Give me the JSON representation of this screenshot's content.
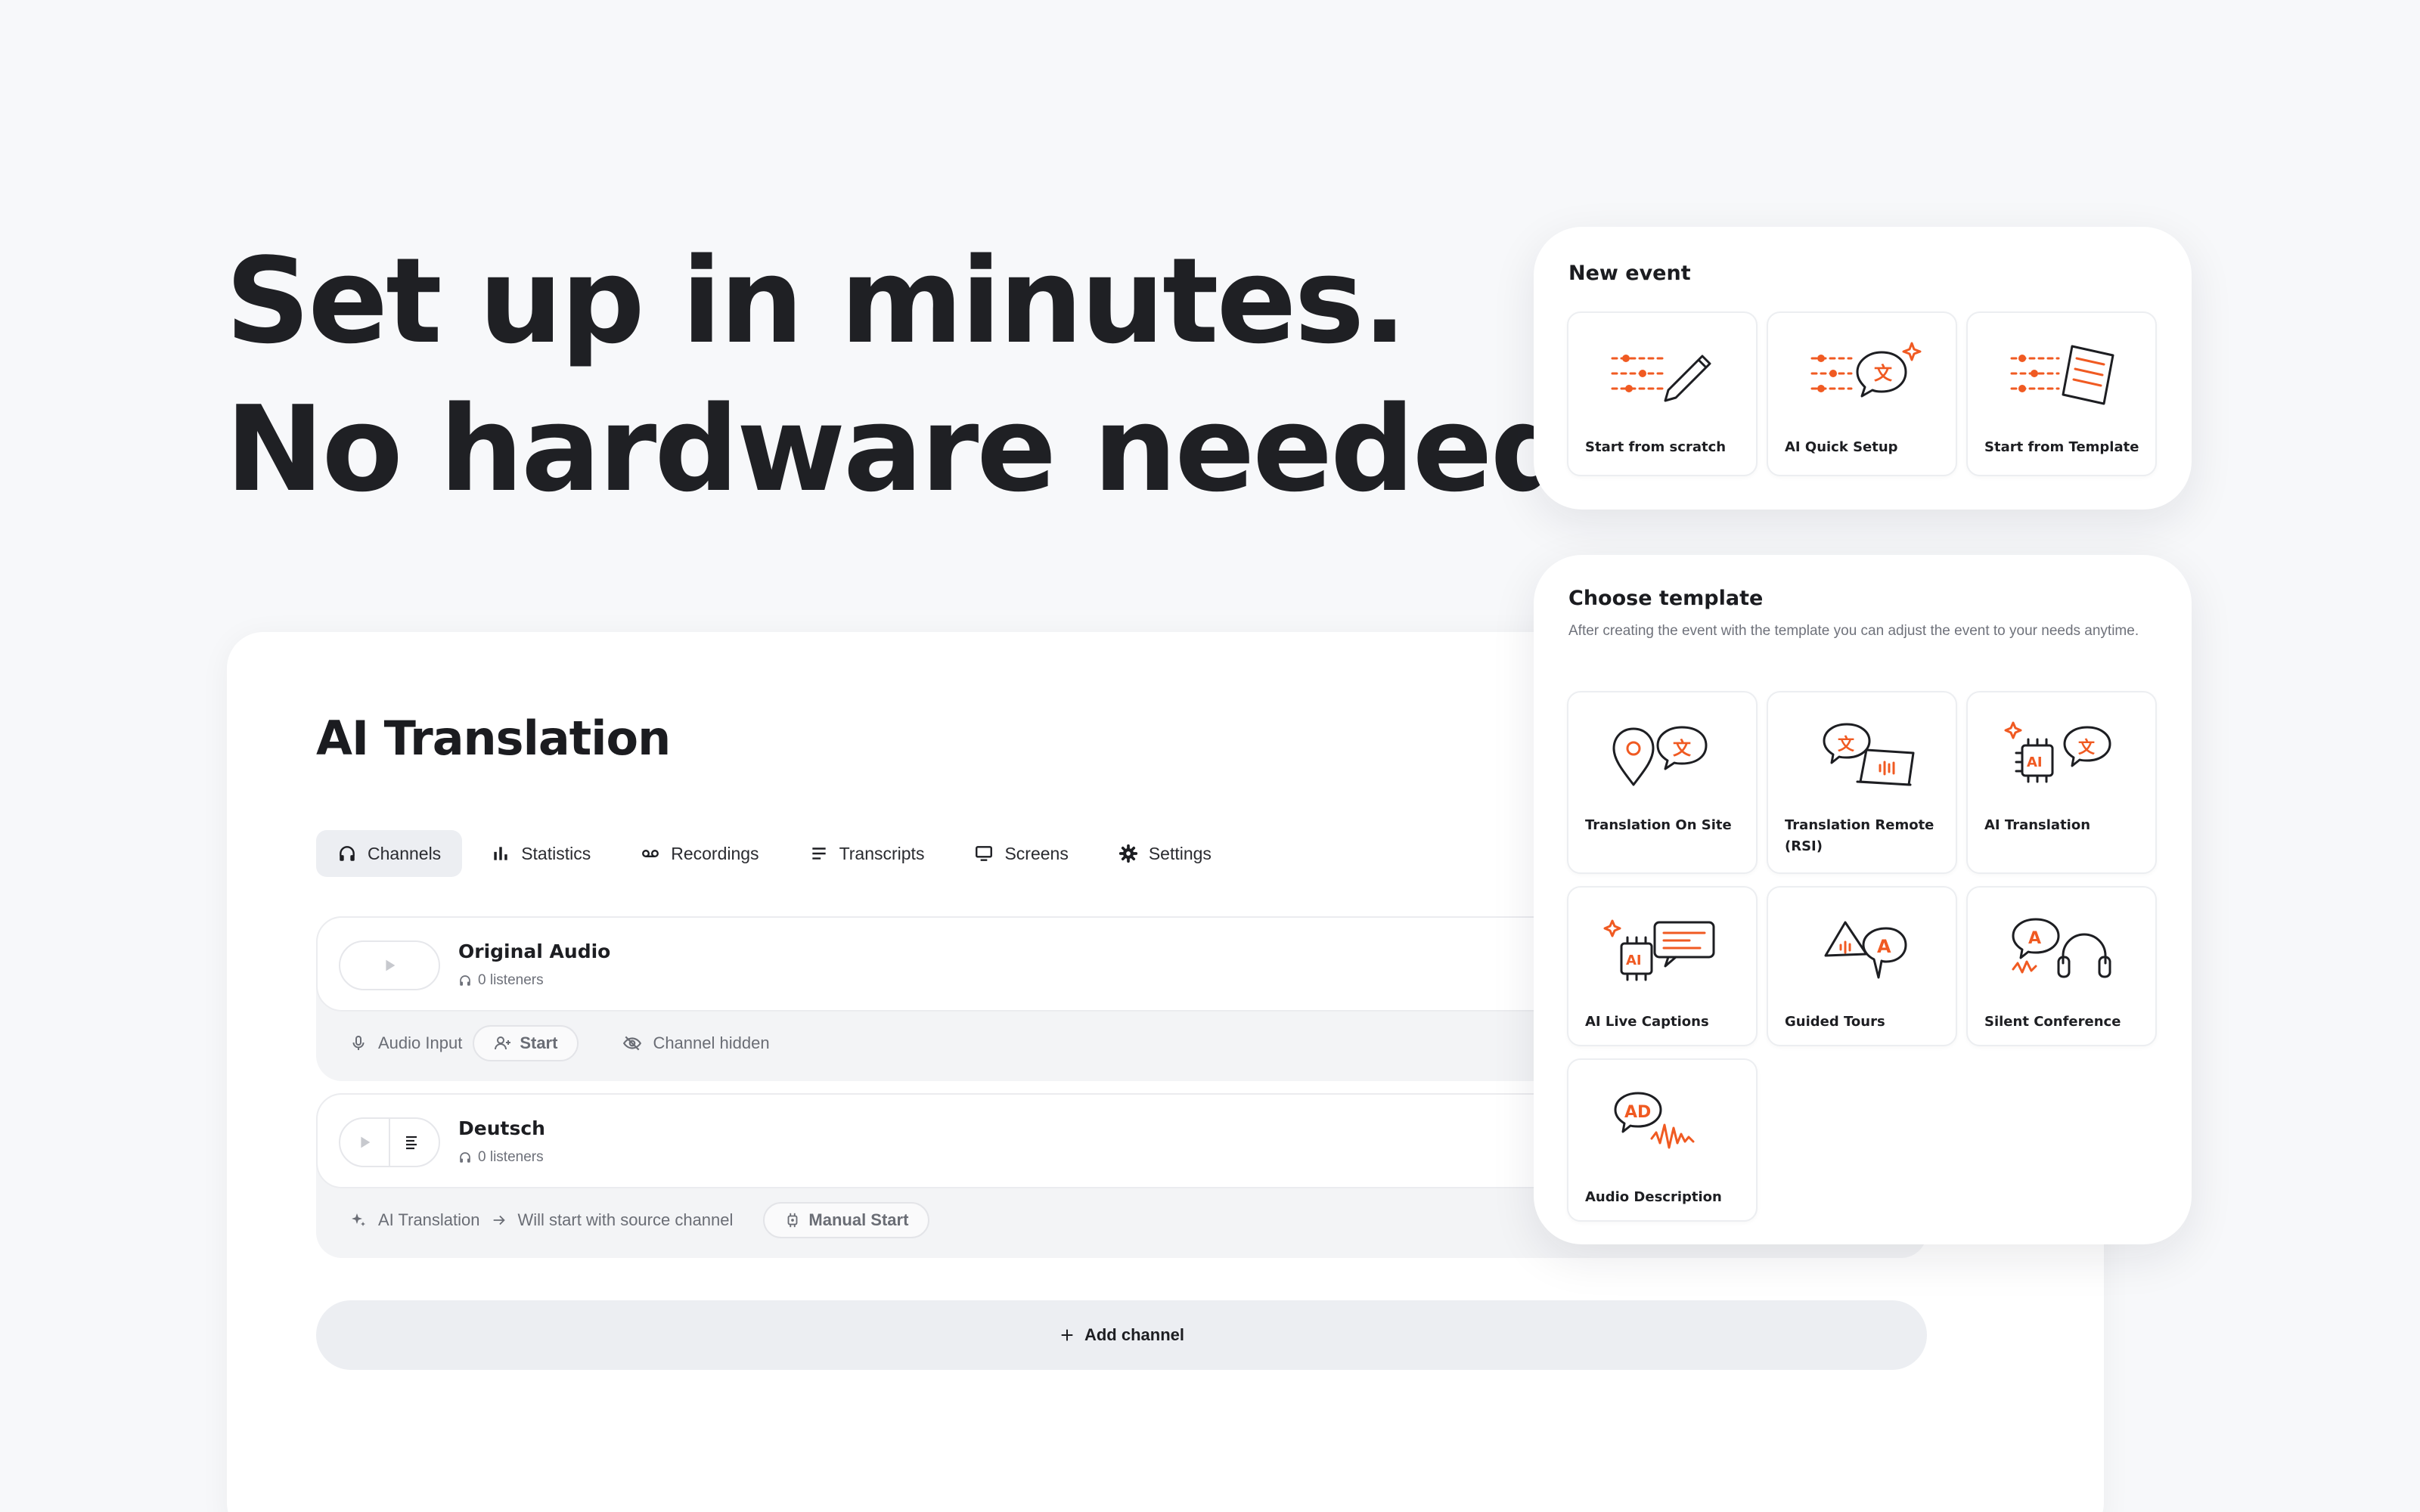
{
  "hero": {
    "line1": "Set up in minutes.",
    "line2": "No hardware needed."
  },
  "app": {
    "title": "AI Translation",
    "tabs": [
      {
        "label": "Channels",
        "icon": "headphones-icon",
        "active": true
      },
      {
        "label": "Statistics",
        "icon": "bar-chart-icon"
      },
      {
        "label": "Recordings",
        "icon": "voicemail-icon"
      },
      {
        "label": "Transcripts",
        "icon": "lines-icon"
      },
      {
        "label": "Screens",
        "icon": "monitor-icon"
      },
      {
        "label": "Settings",
        "icon": "gear-icon"
      }
    ],
    "channels": [
      {
        "name": "Original Audio",
        "listeners": "0 listeners",
        "footer": {
          "input_label": "Audio Input",
          "start_label": "Start",
          "visibility": "Channel hidden"
        }
      },
      {
        "name": "Deutsch",
        "listeners": "0 listeners",
        "footer": {
          "source_label": "AI Translation",
          "source_note": "Will start with source channel",
          "manual_label": "Manual Start"
        }
      }
    ],
    "add_channel_label": "Add channel"
  },
  "new_event": {
    "title": "New event",
    "options": [
      {
        "label": "Start from scratch",
        "icon": "sliders-pencil-icon"
      },
      {
        "label": "AI Quick Setup",
        "icon": "sliders-ai-bubble-icon"
      },
      {
        "label": "Start from Template",
        "icon": "sliders-document-icon"
      }
    ]
  },
  "template": {
    "title": "Choose template",
    "subtitle": "After creating the event with the template you can adjust the event to your needs anytime.",
    "items": [
      {
        "label": "Translation On Site",
        "icon": "location-bubble-icon"
      },
      {
        "label": "Translation Remote (RSI)",
        "icon": "laptop-bubble-icon"
      },
      {
        "label": "AI Translation",
        "icon": "chip-bubble-icon"
      },
      {
        "label": "AI Live Captions",
        "icon": "chip-captions-icon"
      },
      {
        "label": "Guided Tours",
        "icon": "flag-bubble-icon"
      },
      {
        "label": "Silent Conference",
        "icon": "headset-bubble-icon"
      },
      {
        "label": "Audio Description",
        "icon": "ad-waveform-icon"
      }
    ]
  },
  "colors": {
    "accent": "#f05a22",
    "ink": "#1d1e22",
    "background": "#f7f8fa"
  }
}
